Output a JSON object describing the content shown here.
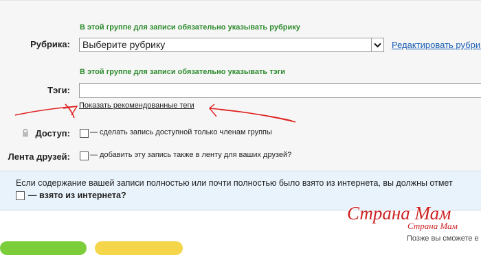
{
  "form": {
    "rubric_hint": "В этой группе для записи обязательно указывать рубрику",
    "rubric_label": "Рубрика:",
    "rubric_select_value": "Выберите рубрику",
    "edit_rubrics_link": "Редактировать рубрики",
    "tags_hint": "В этой группе для записи обязательно указывать тэги",
    "tags_label": "Тэги:",
    "tags_value": "",
    "show_tags_link": "Показать рекомендованные теги",
    "access_label": "Доступ:",
    "access_text": "— сделать запись доступной только членам группы",
    "friends_label": "Лента друзей:",
    "friends_text": "— добавить эту запись также в ленту для ваших друзей?"
  },
  "notice": {
    "text": "Если содержание вашей записи полностью или почти полностью было взято из интернета, вы должны отмет",
    "checkbox_label": "— взято из интернета?"
  },
  "watermark": {
    "logo": "Страна Мам",
    "logo_small": "Страна Мам",
    "line": "Позже вы сможете е"
  },
  "icons": {
    "dropdown": "chevron-down-icon",
    "lock": "lock-icon"
  },
  "colors": {
    "hint_green": "#2e8b2e",
    "link_blue": "#1a5fb4",
    "notice_bg": "#e9f3fb",
    "scribble_red": "#e02020"
  }
}
